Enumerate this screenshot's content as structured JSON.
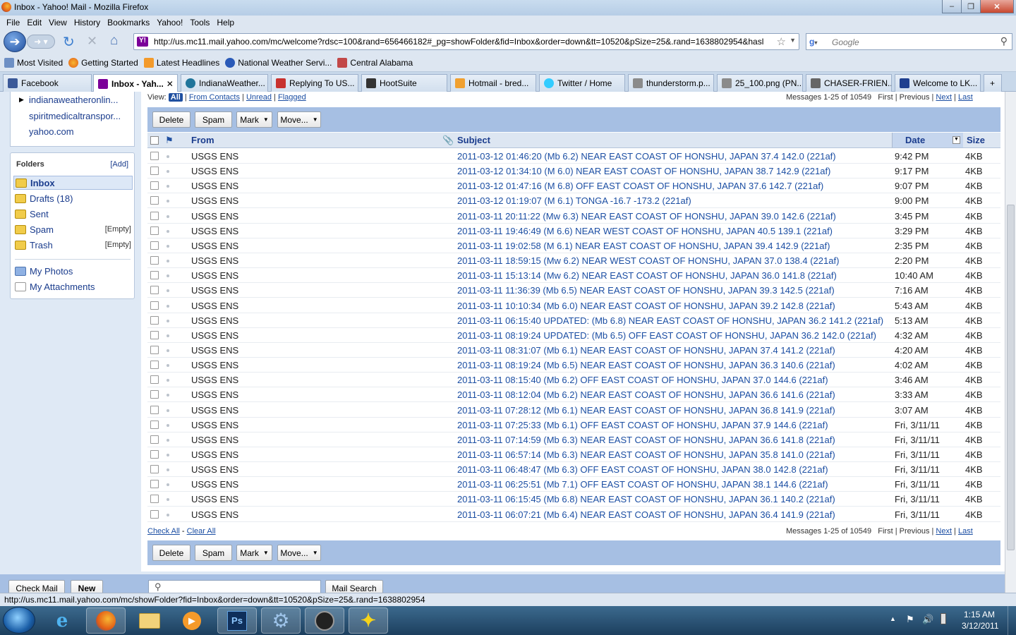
{
  "window": {
    "title": "Inbox - Yahoo! Mail - Mozilla Firefox"
  },
  "menu": [
    "File",
    "Edit",
    "View",
    "History",
    "Bookmarks",
    "Yahoo!",
    "Tools",
    "Help"
  ],
  "address": {
    "url": "http://us.mc11.mail.yahoo.com/mc/welcome?rdsc=100&rand=656466182#_pg=showFolder&fid=Inbox&order=down&tt=10520&pSize=25&.rand=1638802954&hasl"
  },
  "search": {
    "placeholder": "Google"
  },
  "bookmarks": [
    "Most Visited",
    "Getting Started",
    "Latest Headlines",
    "National Weather Servi...",
    "Central Alabama"
  ],
  "tabs": [
    "Facebook",
    "Inbox - Yah...",
    "IndianaWeather...",
    "Replying To US...",
    "HootSuite",
    "Hotmail - bred...",
    "Twitter / Home",
    "thunderstorm.p...",
    "25_100.png (PN...",
    "CHASER-FRIEN...",
    "Welcome to LK..."
  ],
  "sidebar": {
    "contacts": [
      "indianaweatheronlin...",
      "spiritmedicaltranspor...",
      "yahoo.com"
    ],
    "folders_title": "Folders",
    "add_label": "[Add]",
    "folders": [
      {
        "label": "Inbox",
        "extra": ""
      },
      {
        "label": "Drafts (18)",
        "extra": ""
      },
      {
        "label": "Sent",
        "extra": ""
      },
      {
        "label": "Spam",
        "extra": "[Empty]"
      },
      {
        "label": "Trash",
        "extra": "[Empty]"
      }
    ],
    "links": [
      "My Photos",
      "My Attachments"
    ]
  },
  "view": {
    "label": "View:",
    "all": "All",
    "from_contacts": "From Contacts",
    "unread": "Unread",
    "flagged": "Flagged"
  },
  "paging": {
    "messages": "Messages 1-25 of 10549",
    "first": "First",
    "previous": "Previous",
    "next": "Next",
    "last": "Last"
  },
  "toolbar": {
    "delete": "Delete",
    "spam": "Spam",
    "mark": "Mark",
    "move": "Move..."
  },
  "columns": {
    "from": "From",
    "subject": "Subject",
    "date": "Date",
    "size": "Size"
  },
  "messages": [
    {
      "from": "USGS ENS",
      "subject": "2011-03-12 01:46:20 (Mb 6.2) NEAR EAST COAST OF HONSHU, JAPAN 37.4 142.0 (221af)",
      "date": "9:42 PM",
      "size": "4KB"
    },
    {
      "from": "USGS ENS",
      "subject": "2011-03-12 01:34:10 (M 6.0) NEAR EAST COAST OF HONSHU, JAPAN 38.7 142.9 (221af)",
      "date": "9:17 PM",
      "size": "4KB"
    },
    {
      "from": "USGS ENS",
      "subject": "2011-03-12 01:47:16 (M 6.8) OFF EAST COAST OF HONSHU, JAPAN 37.6 142.7 (221af)",
      "date": "9:07 PM",
      "size": "4KB"
    },
    {
      "from": "USGS ENS",
      "subject": "2011-03-12 01:19:07 (M 6.1) TONGA -16.7 -173.2 (221af)",
      "date": "9:00 PM",
      "size": "4KB"
    },
    {
      "from": "USGS ENS",
      "subject": "2011-03-11 20:11:22 (Mw 6.3) NEAR EAST COAST OF HONSHU, JAPAN 39.0 142.6 (221af)",
      "date": "3:45 PM",
      "size": "4KB"
    },
    {
      "from": "USGS ENS",
      "subject": "2011-03-11 19:46:49 (M 6.6) NEAR WEST COAST OF HONSHU, JAPAN 40.5 139.1 (221af)",
      "date": "3:29 PM",
      "size": "4KB"
    },
    {
      "from": "USGS ENS",
      "subject": "2011-03-11 19:02:58 (M 6.1) NEAR EAST COAST OF HONSHU, JAPAN 39.4 142.9 (221af)",
      "date": "2:35 PM",
      "size": "4KB"
    },
    {
      "from": "USGS ENS",
      "subject": "2011-03-11 18:59:15 (Mw 6.2) NEAR WEST COAST OF HONSHU, JAPAN 37.0 138.4 (221af)",
      "date": "2:20 PM",
      "size": "4KB"
    },
    {
      "from": "USGS ENS",
      "subject": "2011-03-11 15:13:14 (Mw 6.2) NEAR EAST COAST OF HONSHU, JAPAN 36.0 141.8 (221af)",
      "date": "10:40 AM",
      "size": "4KB"
    },
    {
      "from": "USGS ENS",
      "subject": "2011-03-11 11:36:39 (Mb 6.5) NEAR EAST COAST OF HONSHU, JAPAN 39.3 142.5 (221af)",
      "date": "7:16 AM",
      "size": "4KB"
    },
    {
      "from": "USGS ENS",
      "subject": "2011-03-11 10:10:34 (Mb 6.0) NEAR EAST COAST OF HONSHU, JAPAN 39.2 142.8 (221af)",
      "date": "5:43 AM",
      "size": "4KB"
    },
    {
      "from": "USGS ENS",
      "subject": "2011-03-11 06:15:40 UPDATED: (Mb 6.8) NEAR EAST COAST OF HONSHU, JAPAN 36.2 141.2 (221af)",
      "date": "5:13 AM",
      "size": "4KB"
    },
    {
      "from": "USGS ENS",
      "subject": "2011-03-11 08:19:24 UPDATED: (Mb 6.5) OFF EAST COAST OF HONSHU, JAPAN 36.2 142.0 (221af)",
      "date": "4:32 AM",
      "size": "4KB"
    },
    {
      "from": "USGS ENS",
      "subject": "2011-03-11 08:31:07 (Mb 6.1) NEAR EAST COAST OF HONSHU, JAPAN 37.4 141.2 (221af)",
      "date": "4:20 AM",
      "size": "4KB"
    },
    {
      "from": "USGS ENS",
      "subject": "2011-03-11 08:19:24 (Mb 6.5) NEAR EAST COAST OF HONSHU, JAPAN 36.3 140.6 (221af)",
      "date": "4:02 AM",
      "size": "4KB"
    },
    {
      "from": "USGS ENS",
      "subject": "2011-03-11 08:15:40 (Mb 6.2) OFF EAST COAST OF HONSHU, JAPAN 37.0 144.6 (221af)",
      "date": "3:46 AM",
      "size": "4KB"
    },
    {
      "from": "USGS ENS",
      "subject": "2011-03-11 08:12:04 (Mb 6.2) NEAR EAST COAST OF HONSHU, JAPAN 36.6 141.6 (221af)",
      "date": "3:33 AM",
      "size": "4KB"
    },
    {
      "from": "USGS ENS",
      "subject": "2011-03-11 07:28:12 (Mb 6.1) NEAR EAST COAST OF HONSHU, JAPAN 36.8 141.9 (221af)",
      "date": "3:07 AM",
      "size": "4KB"
    },
    {
      "from": "USGS ENS",
      "subject": "2011-03-11 07:25:33 (Mb 6.1) OFF EAST COAST OF HONSHU, JAPAN 37.9 144.6 (221af)",
      "date": "Fri, 3/11/11",
      "size": "4KB"
    },
    {
      "from": "USGS ENS",
      "subject": "2011-03-11 07:14:59 (Mb 6.3) NEAR EAST COAST OF HONSHU, JAPAN 36.6 141.8 (221af)",
      "date": "Fri, 3/11/11",
      "size": "4KB"
    },
    {
      "from": "USGS ENS",
      "subject": "2011-03-11 06:57:14 (Mb 6.3) NEAR EAST COAST OF HONSHU, JAPAN 35.8 141.0 (221af)",
      "date": "Fri, 3/11/11",
      "size": "4KB"
    },
    {
      "from": "USGS ENS",
      "subject": "2011-03-11 06:48:47 (Mb 6.3) OFF EAST COAST OF HONSHU, JAPAN 38.0 142.8 (221af)",
      "date": "Fri, 3/11/11",
      "size": "4KB"
    },
    {
      "from": "USGS ENS",
      "subject": "2011-03-11 06:25:51 (Mb 7.1) OFF EAST COAST OF HONSHU, JAPAN 38.1 144.6 (221af)",
      "date": "Fri, 3/11/11",
      "size": "4KB"
    },
    {
      "from": "USGS ENS",
      "subject": "2011-03-11 06:15:45 (Mb 6.8) NEAR EAST COAST OF HONSHU, JAPAN 36.1 140.2 (221af)",
      "date": "Fri, 3/11/11",
      "size": "4KB"
    },
    {
      "from": "USGS ENS",
      "subject": "2011-03-11 06:07:21 (Mb 6.4) NEAR EAST COAST OF HONSHU, JAPAN 36.4 141.9 (221af)",
      "date": "Fri, 3/11/11",
      "size": "4KB"
    }
  ],
  "footer_links": {
    "check_all": "Check All",
    "clear_all": "Clear All"
  },
  "bottom": {
    "check_mail": "Check Mail",
    "new": "New",
    "mail_search": "Mail Search"
  },
  "status": "http://us.mc11.mail.yahoo.com/mc/showFolder?fid=Inbox&order=down&tt=10520&pSize=25&.rand=1638802954",
  "clock": {
    "time": "1:15 AM",
    "date": "3/12/2011"
  },
  "colors": {
    "accent": "#a6bfe3",
    "link": "#1b4ea3",
    "frame": "#dde6f1"
  }
}
